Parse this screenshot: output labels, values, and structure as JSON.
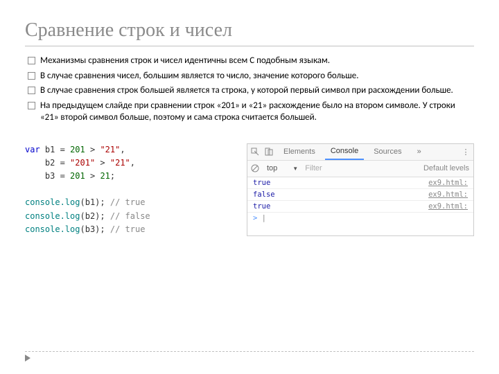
{
  "title": "Сравнение строк и чисел",
  "bullets": [
    "Механизмы сравнения строк и чисел идентичны всем C подобным языкам.",
    "В случае сравнения чисел, большим является то число, значение которого больше.",
    "В случае сравнения строк большей является та строка, у которой первый символ при расхождении больше.",
    "На предыдущем слайде при сравнении строк «201» и «21» расхождение было на втором символе. У строки «21» второй символ больше, поэтому и сама строка считается большей."
  ],
  "code": {
    "kw_var": "var",
    "b1_name": "b1",
    "b1_lhs": "201",
    "b1_op": ">",
    "b1_rhs": "\"21\"",
    "b2_name": "b2",
    "b2_lhs": "\"201\"",
    "b2_op": ">",
    "b2_rhs": "\"21\"",
    "b3_name": "b3",
    "b3_lhs": "201",
    "b3_op": ">",
    "b3_rhs": "21",
    "log_fn": "console.log",
    "c1": "// true",
    "c2": "// false",
    "c3": "// true"
  },
  "devtools": {
    "tabs": {
      "elements": "Elements",
      "console": "Console",
      "sources": "Sources",
      "more": "»"
    },
    "toolbar": {
      "context": "top",
      "filter": "Filter",
      "levels": "Default levels"
    },
    "rows": [
      {
        "val": "true",
        "src": "ex9.html:"
      },
      {
        "val": "false",
        "src": "ex9.html:"
      },
      {
        "val": "true",
        "src": "ex9.html:"
      }
    ],
    "prompt": ">"
  }
}
